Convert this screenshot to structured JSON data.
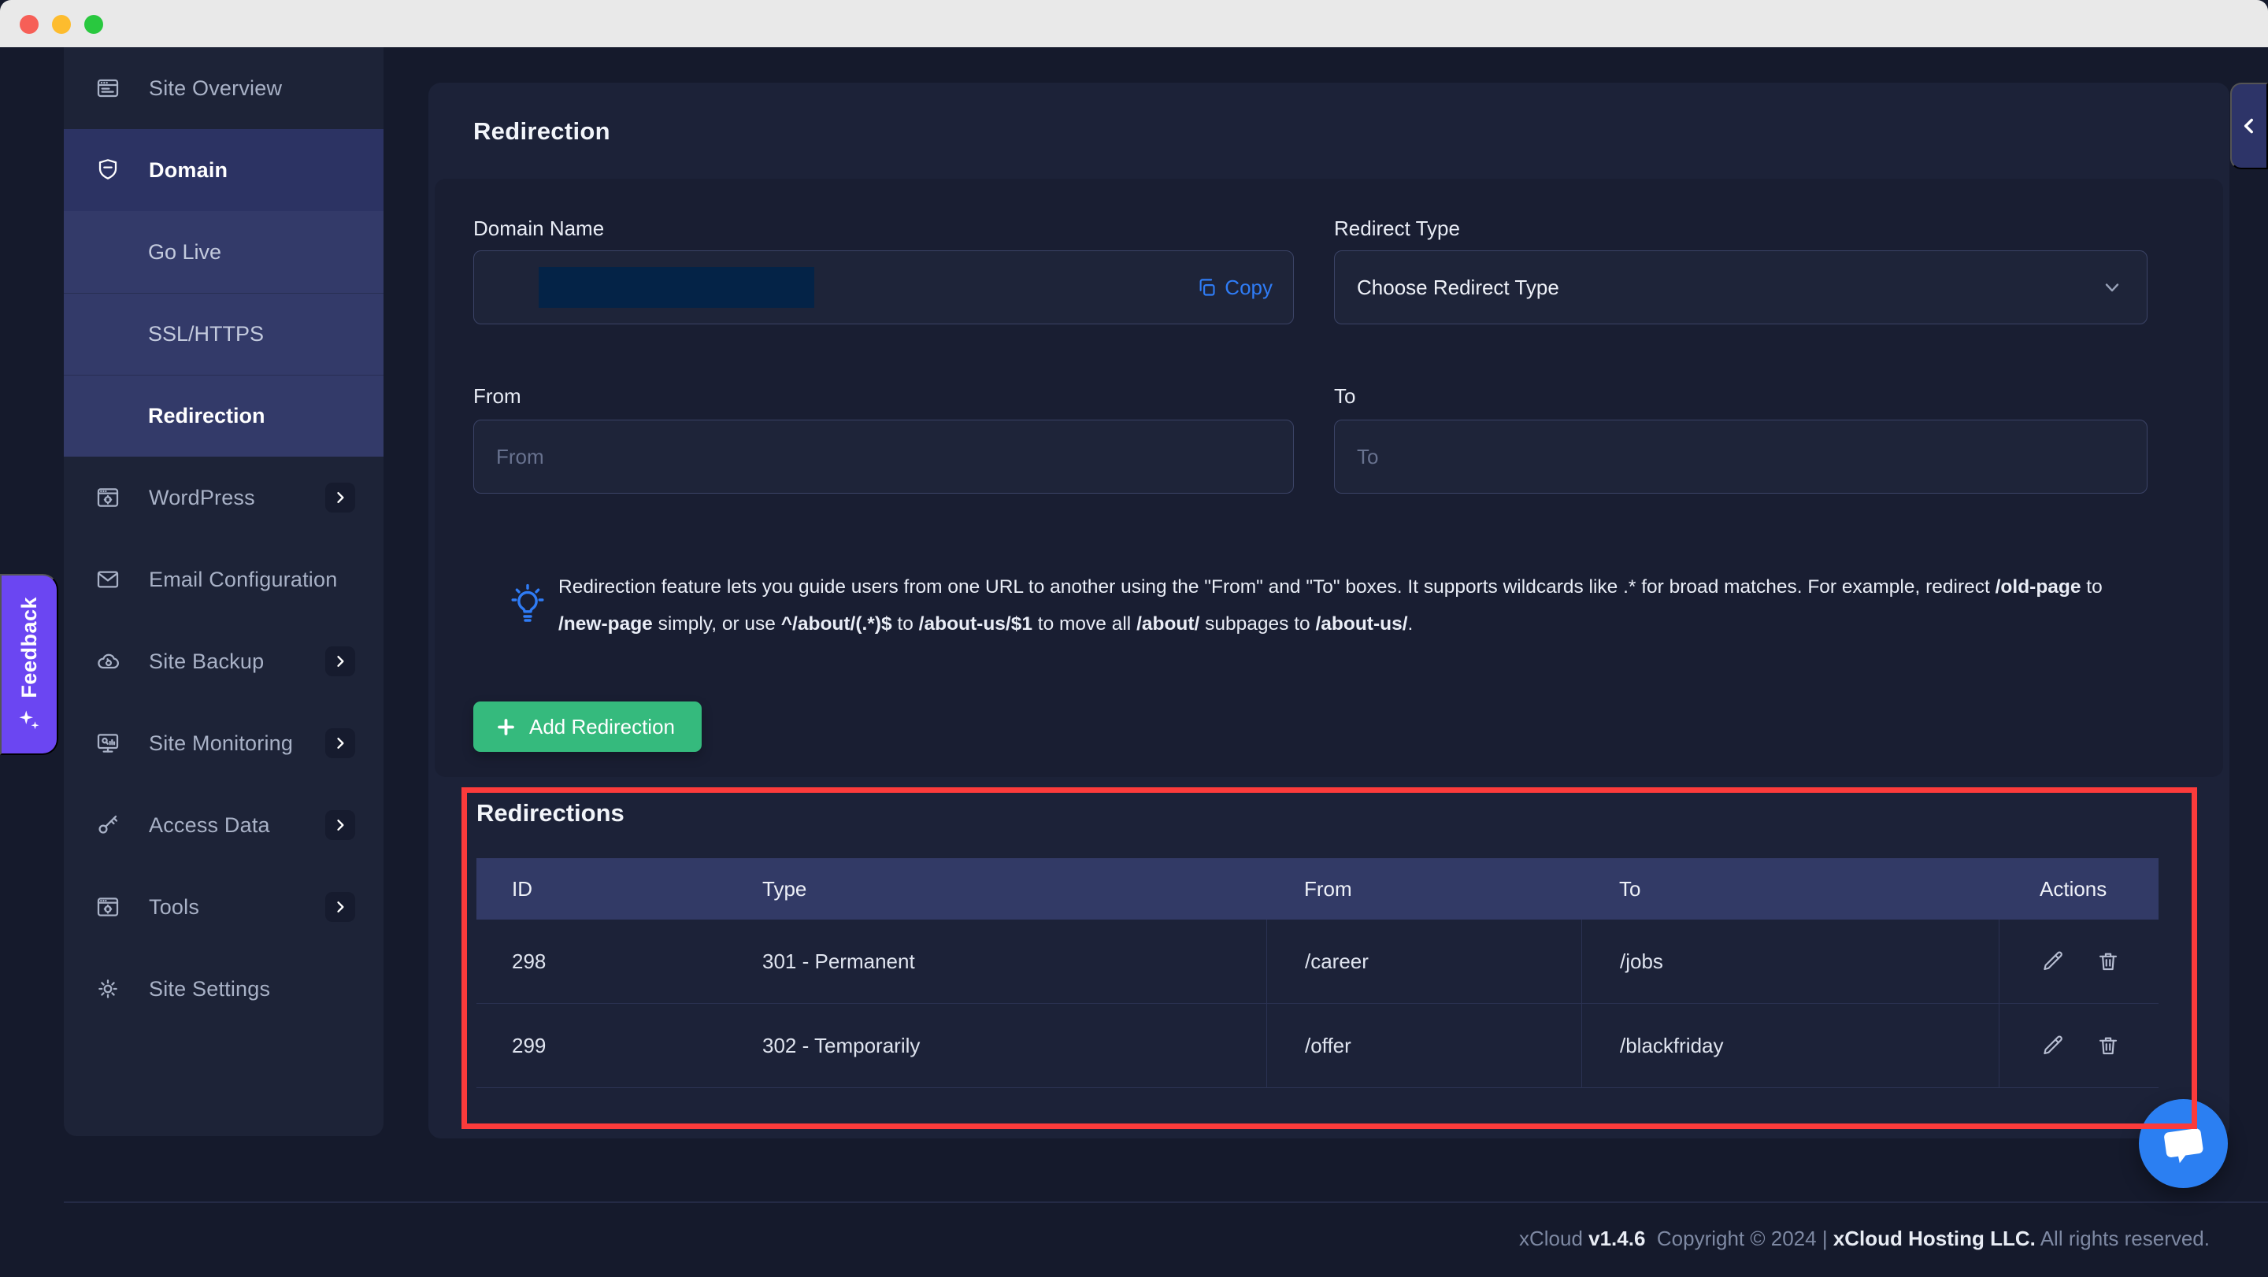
{
  "window": {
    "controls": [
      "close",
      "minimize",
      "maximize"
    ]
  },
  "sidebar": {
    "items": [
      {
        "label": "Site Overview",
        "icon": "browser-window-icon"
      },
      {
        "label": "Domain",
        "icon": "shield-icon",
        "state": "active-parent"
      },
      {
        "label": "Go Live",
        "type": "sub-item"
      },
      {
        "label": "SSL/HTTPS",
        "type": "sub-item"
      },
      {
        "label": "Redirection",
        "type": "sub-item",
        "state": "active"
      },
      {
        "label": "WordPress",
        "icon": "browser-gear-icon",
        "expandable": true
      },
      {
        "label": "Email Configuration",
        "icon": "envelope-icon"
      },
      {
        "label": "Site Backup",
        "icon": "cloud-icon",
        "expandable": true
      },
      {
        "label": "Site Monitoring",
        "icon": "monitor-icon",
        "expandable": true
      },
      {
        "label": "Access Data",
        "icon": "key-icon",
        "expandable": true
      },
      {
        "label": "Tools",
        "icon": "browser-gear-icon",
        "expandable": true
      },
      {
        "label": "Site Settings",
        "icon": "gear-icon"
      }
    ],
    "feedback_label": "Feedback"
  },
  "main": {
    "title": "Redirection",
    "form": {
      "domain_name": {
        "label": "Domain Name",
        "copy_label": "Copy",
        "value_redacted": true
      },
      "redirect_type": {
        "label": "Redirect Type",
        "value": "Choose Redirect Type"
      },
      "from": {
        "label": "From",
        "placeholder": "From"
      },
      "to": {
        "label": "To",
        "placeholder": "To"
      }
    },
    "info": {
      "segments": [
        {
          "t": "Redirection feature lets you guide users from one URL to another using the \"From\" and \"To\" boxes. It supports wildcards like .* for broad matches. For example, redirect ",
          "b": false
        },
        {
          "t": "/old-page",
          "b": true
        },
        {
          "t": " to ",
          "b": false
        },
        {
          "t": "/new-page",
          "b": true
        },
        {
          "t": " simply, or use ",
          "b": false
        },
        {
          "t": "^/about/(.*)$",
          "b": true
        },
        {
          "t": " to ",
          "b": false
        },
        {
          "t": "/about-us/$1",
          "b": true
        },
        {
          "t": " to move all ",
          "b": false
        },
        {
          "t": "/about/",
          "b": true
        },
        {
          "t": " subpages to ",
          "b": false
        },
        {
          "t": "/about-us/",
          "b": true
        },
        {
          "t": ".",
          "b": false
        }
      ]
    },
    "add_button_label": "Add Redirection",
    "redirections": {
      "title": "Redirections",
      "columns": [
        "ID",
        "Type",
        "From",
        "To",
        "Actions"
      ],
      "rows": [
        {
          "id": "298",
          "type": "301 - Permanent",
          "from": "/career",
          "to": "/jobs"
        },
        {
          "id": "299",
          "type": "302 - Temporarily",
          "from": "/offer",
          "to": "/blackfriday"
        }
      ]
    }
  },
  "footer": {
    "segments": [
      "xCloud ",
      "v1.4.6",
      "  Copyright © 2024 | ",
      "xCloud Hosting LLC.",
      " All rights reserved."
    ]
  },
  "colors": {
    "accent_red": "#fb3b3b",
    "accent_green": "#35ba7d",
    "accent_blue": "#2f7cf6",
    "accent_purple": "#6b46f2",
    "page_bg": "#151a2c",
    "sidebar_bg": "#1d2337",
    "card_bg": "#1c2238",
    "panel_bg": "#191e32",
    "active_parent_bg": "#2c3363",
    "submenu_bg": "#333a69",
    "table_header_bg": "#323a66",
    "chat_blue": "#2b7ff2",
    "topbar_bg": "#e9e9e9",
    "redacted_bg": "#042347"
  }
}
